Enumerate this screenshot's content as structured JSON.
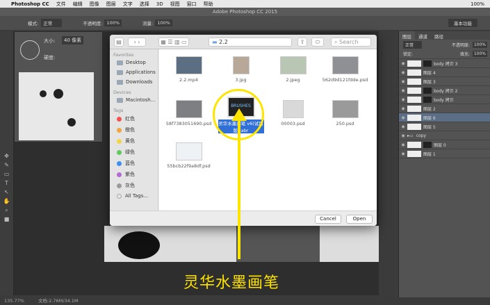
{
  "menubar": {
    "app": "Photoshop CC",
    "items": [
      "文件",
      "编辑",
      "图像",
      "图层",
      "文字",
      "选择",
      "3D",
      "视图",
      "窗口",
      "帮助"
    ],
    "status": "100%"
  },
  "window": {
    "title": "Adobe Photoshop CC 2015",
    "workspace": "基本功能"
  },
  "options": {
    "mode_label": "模式:",
    "mode_value": "正常",
    "opacity_label": "不透明度:",
    "opacity_value": "100%",
    "flow_label": "流量:",
    "flow_value": "100%"
  },
  "brush": {
    "size_label": "大小:",
    "size_value": "40 像素",
    "hardness_label": "硬度:"
  },
  "dialog": {
    "path": "2.2",
    "search_placeholder": "Search",
    "favorites_header": "Favorites",
    "favorites": [
      "Desktop",
      "Applications",
      "Downloads"
    ],
    "devices_header": "Devices",
    "devices": [
      "Macintosh..."
    ],
    "tags_header": "Tags",
    "tags": [
      {
        "name": "红色",
        "color": "#f2534f"
      },
      {
        "name": "橙色",
        "color": "#f5a43b"
      },
      {
        "name": "黄色",
        "color": "#f2d546"
      },
      {
        "name": "绿色",
        "color": "#5fc85e"
      },
      {
        "name": "蓝色",
        "color": "#3b8ff0"
      },
      {
        "name": "紫色",
        "color": "#b56bd3"
      },
      {
        "name": "灰色",
        "color": "#9b9b9b"
      }
    ],
    "all_tags": "All Tags...",
    "files": [
      {
        "name": "2.2.mp4"
      },
      {
        "name": "3.jpg"
      },
      {
        "name": "2.jpeg"
      },
      {
        "name": "562d9d121fdde.psd"
      },
      {
        "name": "58f7383051690.psd"
      },
      {
        "name": "灵华水墨画笔 v6(试用版).abr",
        "thumb_label": "BRUSHES",
        "selected": true
      },
      {
        "name": "00003.psd"
      },
      {
        "name": "250.psd"
      },
      {
        "name": "55bcb22f9a8df.psd"
      }
    ],
    "cancel": "Cancel",
    "open": "Open"
  },
  "layers": {
    "tab1": "图层",
    "tab2": "通道",
    "tab3": "路径",
    "kind": "正常",
    "opacity_label": "不透明度:",
    "opacity": "100%",
    "lock_label": "锁定:",
    "fill_label": "填充:",
    "fill": "100%",
    "items": [
      {
        "name": "body 拷贝 3",
        "selected": false
      },
      {
        "name": "图层 4",
        "selected": false
      },
      {
        "name": "图层 3",
        "selected": false
      },
      {
        "name": "body 拷贝 2",
        "selected": false
      },
      {
        "name": "body 拷贝",
        "selected": false
      },
      {
        "name": "图层 2",
        "selected": false
      },
      {
        "name": "图层 6",
        "selected": true
      },
      {
        "name": "图层 5",
        "selected": false
      },
      {
        "name": "copy",
        "selected": false
      },
      {
        "name": "图层 0",
        "selected": false
      },
      {
        "name": "图层 1",
        "selected": false
      }
    ]
  },
  "status": {
    "zoom": "135.77%",
    "doc": "文档:2.76M/34.1M"
  },
  "caption": "灵华水墨画笔"
}
